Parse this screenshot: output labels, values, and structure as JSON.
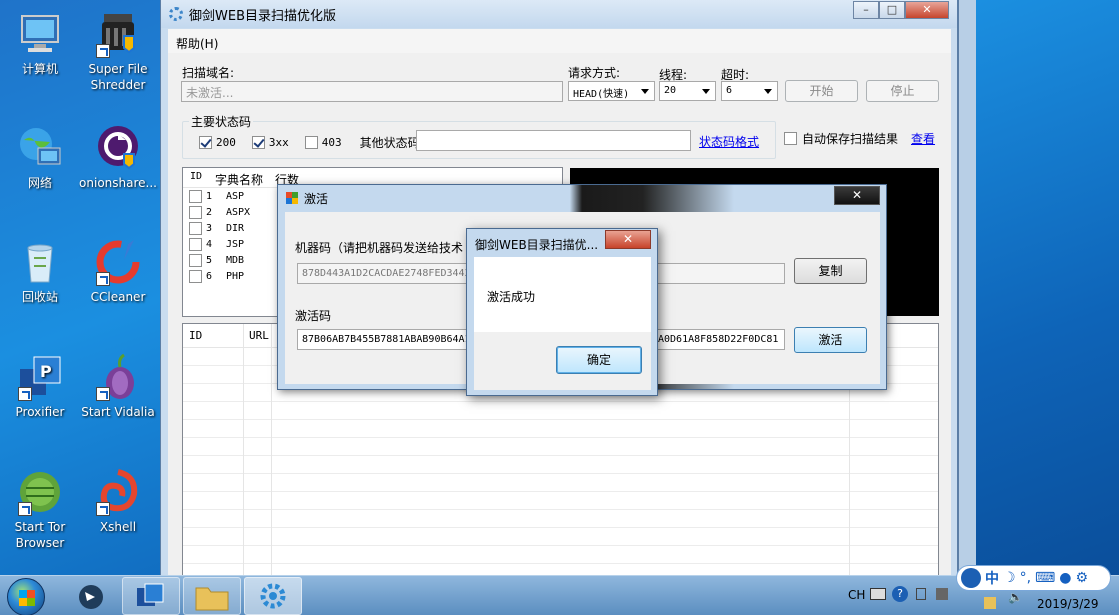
{
  "desktop": {
    "icons": [
      {
        "label": "计算机",
        "icon": "computer-icon"
      },
      {
        "label": "Super File Shredder",
        "icon": "shredder-icon"
      },
      {
        "label": "网络",
        "icon": "network-icon"
      },
      {
        "label": "onionshare...",
        "icon": "onionshare-icon"
      },
      {
        "label": "回收站",
        "icon": "recycle-bin-icon"
      },
      {
        "label": "CCleaner",
        "icon": "ccleaner-icon"
      },
      {
        "label": "Proxifier",
        "icon": "proxifier-icon"
      },
      {
        "label": "Start Vidalia",
        "icon": "onion-icon"
      },
      {
        "label": "Start Tor Browser",
        "icon": "tor-browser-icon"
      },
      {
        "label": "Xshell",
        "icon": "xshell-icon"
      }
    ]
  },
  "main_window": {
    "title": "御剑WEB目录扫描优化版",
    "menu": {
      "help": "帮助(H)"
    },
    "scan": {
      "domain_label": "扫描域名:",
      "domain_placeholder": "未激活...",
      "method_label": "请求方式:",
      "method_value": "HEAD(快速)",
      "threads_label": "线程:",
      "threads_value": "20",
      "timeout_label": "超时:",
      "timeout_value": "6",
      "start_button": "开始",
      "stop_button": "停止"
    },
    "status_codes": {
      "group_title": "主要状态码",
      "codes": [
        {
          "label": "200",
          "checked": true
        },
        {
          "label": "3xx",
          "checked": true
        },
        {
          "label": "403",
          "checked": false
        }
      ],
      "other_label": "其他状态码:",
      "format_link": "状态码格式",
      "autosave_label": "自动保存扫描结果",
      "view_link": "查看"
    },
    "dictionary": {
      "headers": [
        "ID",
        "字典名称",
        "行数"
      ],
      "rows": [
        {
          "id": "1",
          "name": "ASP"
        },
        {
          "id": "2",
          "name": "ASPX"
        },
        {
          "id": "3",
          "name": "DIR"
        },
        {
          "id": "4",
          "name": "JSP"
        },
        {
          "id": "5",
          "name": "MDB"
        },
        {
          "id": "6",
          "name": "PHP"
        }
      ]
    },
    "results": {
      "headers": [
        "ID",
        "URL"
      ]
    }
  },
  "activation_dialog": {
    "title": "激活",
    "machine_code_label": "机器码（请把机器码发送给技术",
    "machine_code_value": "878D443A1D2CACDAE2748FED3443",
    "copy_button": "复制",
    "activation_code_label": "激活码",
    "activation_code_left": "87B06AB7B455B7881ABAB90B64A15",
    "activation_code_right": "A0D61A8F858D22F0DC81",
    "activate_button": "激活"
  },
  "success_popup": {
    "title": "御剑WEB目录扫描优...",
    "message": "激活成功",
    "ok_button": "确定"
  },
  "taskbar": {
    "lang": "CH",
    "date": "2019/3/29"
  },
  "ime": {
    "label": "中"
  }
}
